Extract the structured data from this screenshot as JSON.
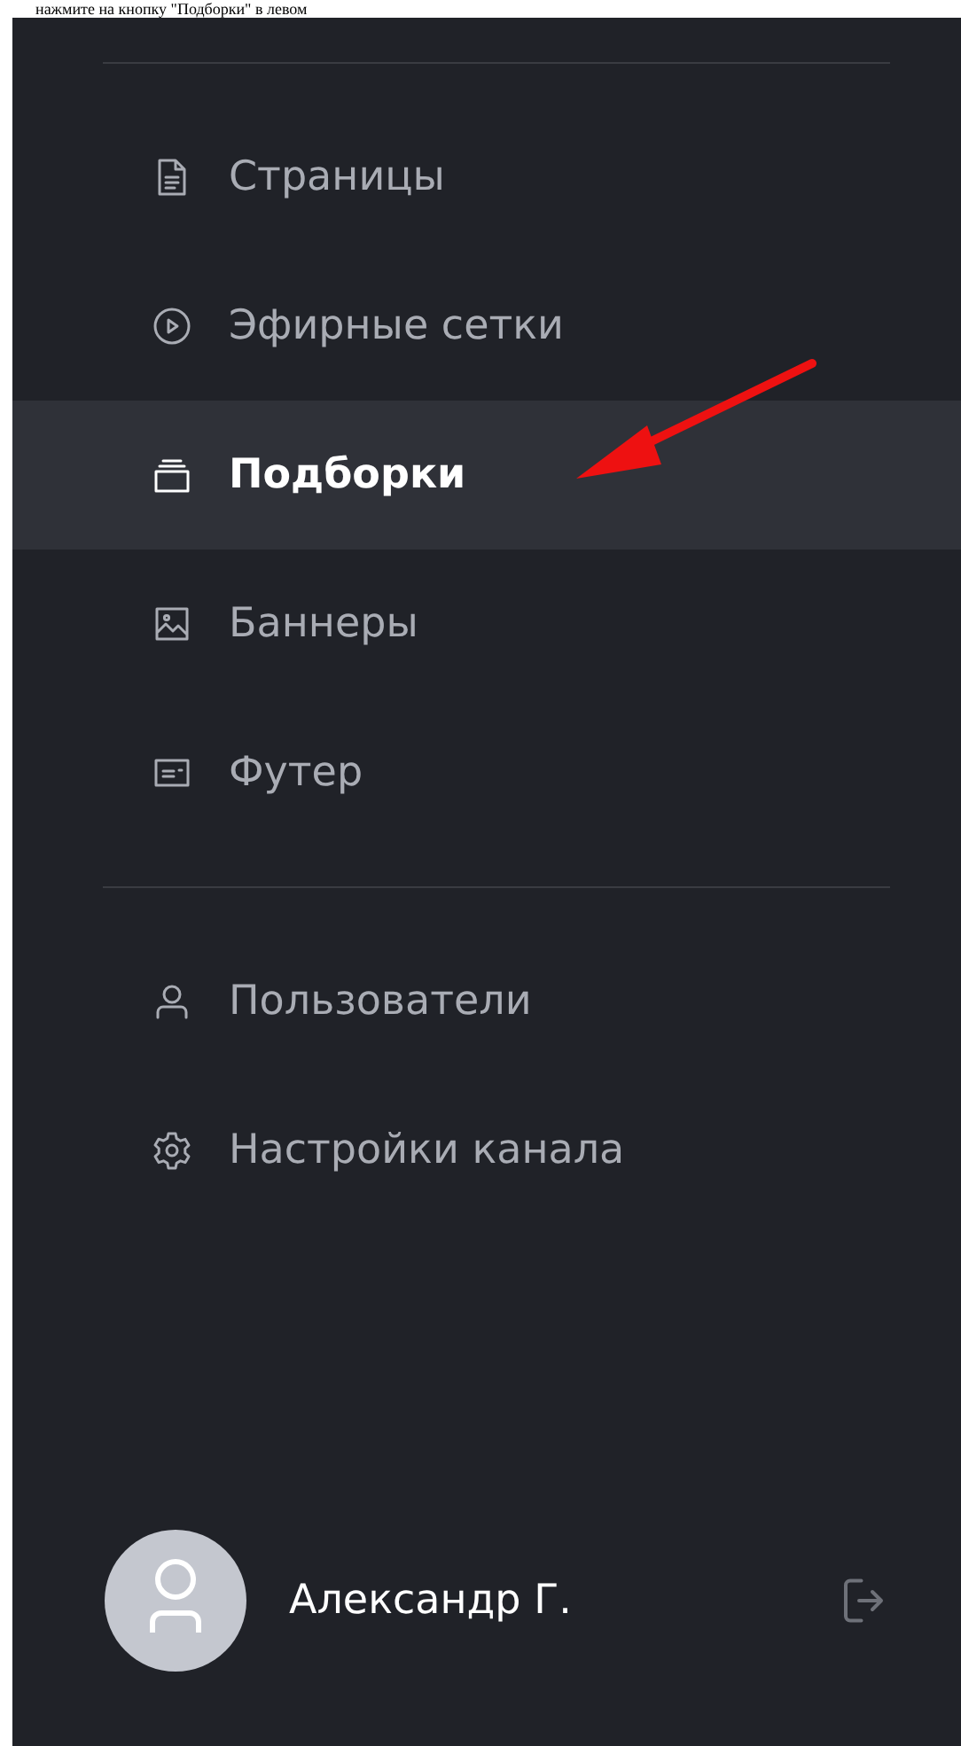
{
  "caption": "нажмите на кнопку \"Подборки\" в левом",
  "sidebar": {
    "groups": [
      {
        "items": [
          {
            "kind": "pages",
            "label": "Страницы",
            "selected": false
          },
          {
            "kind": "schedule",
            "label": "Эфирные сетки",
            "selected": false
          },
          {
            "kind": "collections",
            "label": "Подборки",
            "selected": true
          },
          {
            "kind": "banners",
            "label": "Баннеры",
            "selected": false
          },
          {
            "kind": "footer",
            "label": "Футер",
            "selected": false
          }
        ]
      },
      {
        "items": [
          {
            "kind": "users",
            "label": "Пользователи",
            "selected": false
          },
          {
            "kind": "settings",
            "label": "Настройки канала",
            "selected": false
          }
        ]
      }
    ]
  },
  "user": {
    "name": "Александр Г."
  }
}
